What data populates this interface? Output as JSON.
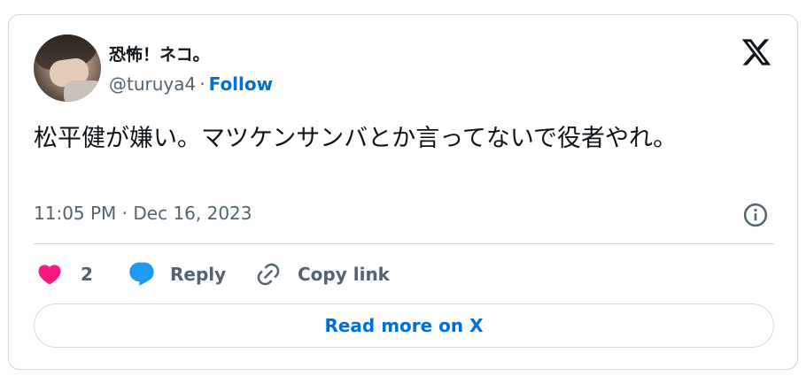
{
  "author": {
    "display_name": "恐怖！ネコ。",
    "handle": "@turuya4",
    "separator": "·",
    "follow_label": "Follow"
  },
  "tweet": {
    "text": "松平健が嫌い。マツケンサンバとか言ってないで役者やれ。",
    "timestamp": "11:05 PM · Dec 16, 2023"
  },
  "actions": {
    "like_count": "2",
    "reply_label": "Reply",
    "copy_label": "Copy link"
  },
  "read_more_label": "Read more on X",
  "colors": {
    "accent": "#006fd6",
    "like": "#f91880",
    "reply_icon": "#1d9bf0",
    "muted": "#536471",
    "border": "#cfd9de"
  },
  "icons": [
    "x-logo-icon",
    "info-icon",
    "heart-icon",
    "reply-bubble-icon",
    "link-icon"
  ]
}
